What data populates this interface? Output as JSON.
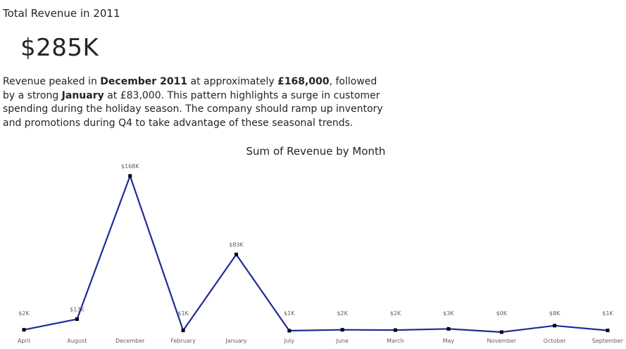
{
  "card": {
    "title": "Total Revenue in 2011",
    "value": "$285K"
  },
  "narrative": {
    "p1": "Revenue peaked in ",
    "b1": "December 2011",
    "p2": " at approximately ",
    "b2": "£168,000",
    "p3": ", followed by a strong ",
    "b3": "January",
    "p4": " at £83,000. This pattern highlights a surge in customer spending during the holiday season. The company should ramp up inventory and promotions during Q4 to take advantage of these seasonal trends."
  },
  "chart_data": {
    "type": "line",
    "title": "Sum of Revenue by Month",
    "categories": [
      "April",
      "August",
      "December",
      "February",
      "January",
      "July",
      "June",
      "March",
      "May",
      "November",
      "October",
      "September"
    ],
    "values": [
      1.5,
      13,
      168,
      0.8,
      83,
      0.5,
      1.5,
      1.2,
      2.5,
      -1,
      6,
      0.8
    ],
    "data_labels": [
      "$2K",
      "$13K",
      "$168K",
      "$1K",
      "$83K",
      "$1K",
      "$2K",
      "$2K",
      "$3K",
      "$0K",
      "$8K",
      "$1K"
    ],
    "xlabel": "",
    "ylabel": "",
    "ylim": [
      -1,
      168
    ],
    "grid": false,
    "legend": "none",
    "colors": {
      "line": "#1f2b96",
      "marker": "#000000"
    }
  }
}
